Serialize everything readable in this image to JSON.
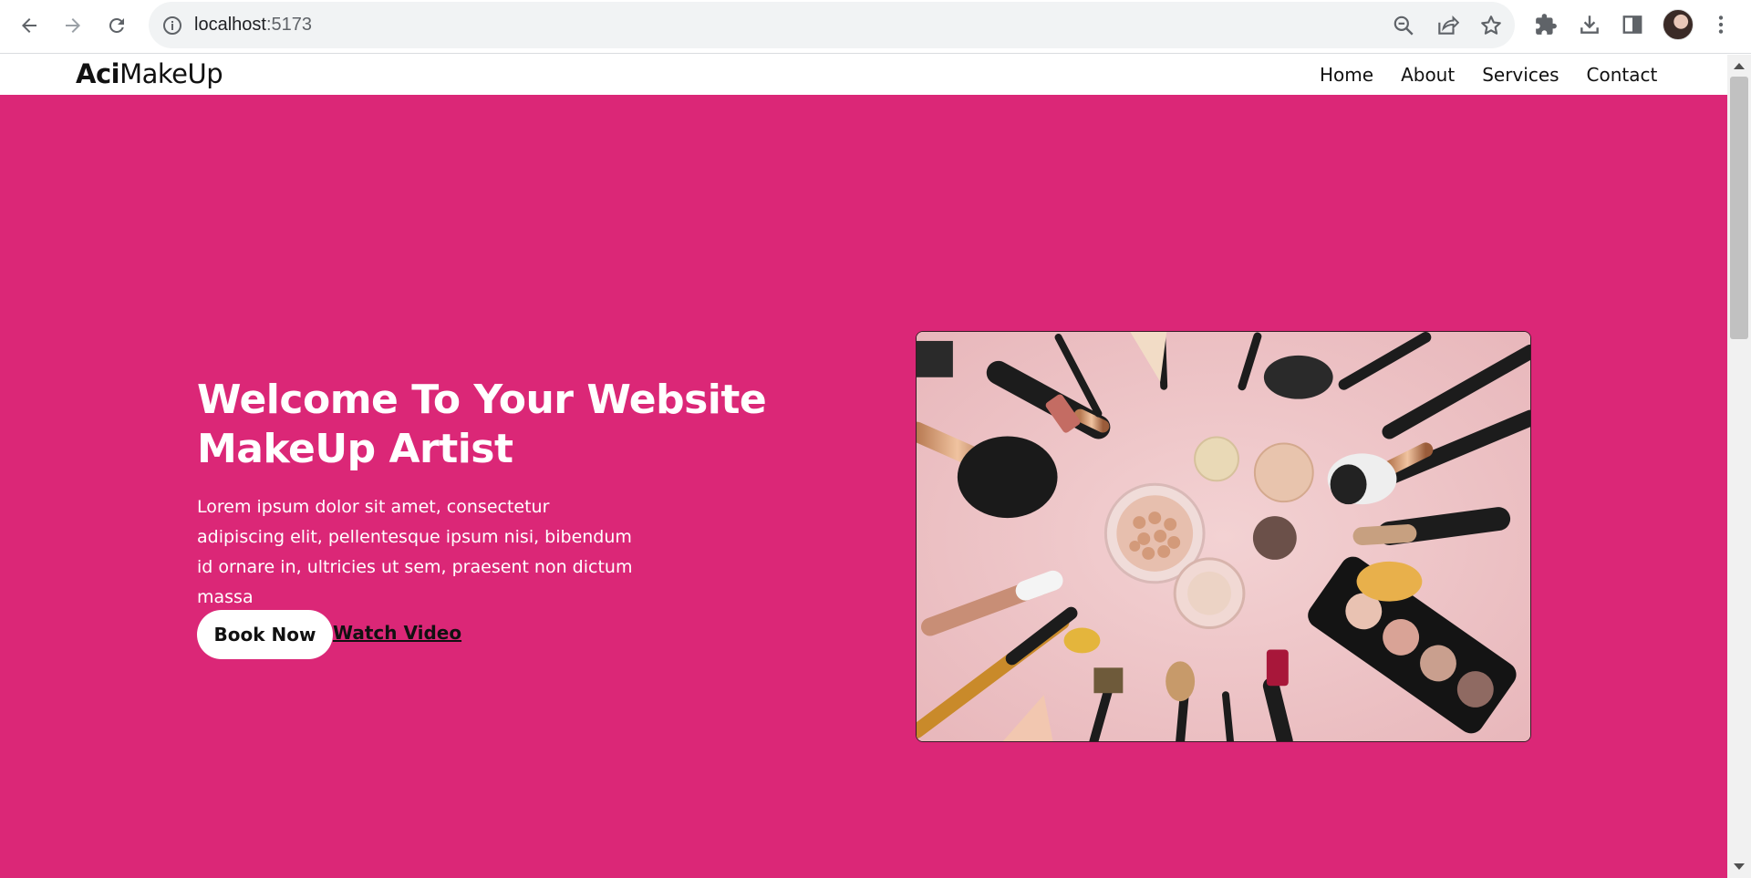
{
  "browser": {
    "url_host": "localhost",
    "url_port": ":5173",
    "icons": {
      "back": "back-arrow-icon",
      "forward": "forward-arrow-icon",
      "reload": "reload-icon",
      "site_info": "info-icon",
      "zoom": "zoom-out-icon",
      "share": "share-icon",
      "bookmark": "star-icon",
      "extensions": "puzzle-icon",
      "downloads": "download-icon",
      "side_panel": "side-panel-icon",
      "menu": "kebab-menu-icon"
    }
  },
  "site": {
    "logo_bold": "Aci",
    "logo_regular": "MakeUp",
    "nav": [
      "Home",
      "About",
      "Services",
      "Contact"
    ]
  },
  "hero": {
    "title": "Welcome To Your Website MakeUp Artist",
    "text": "Lorem ipsum dolor sit amet, consectetur adipiscing elit, pellentesque ipsum nisi, bibendum id ornare in, ultricies ut sem, praesent non dictum massa",
    "book_button": "Book Now",
    "video_link": "Watch Video"
  },
  "colors": {
    "hero_background": "#db2777",
    "header_background": "#ffffff",
    "button_background": "#ffffff",
    "text_on_hero": "#ffffff"
  }
}
